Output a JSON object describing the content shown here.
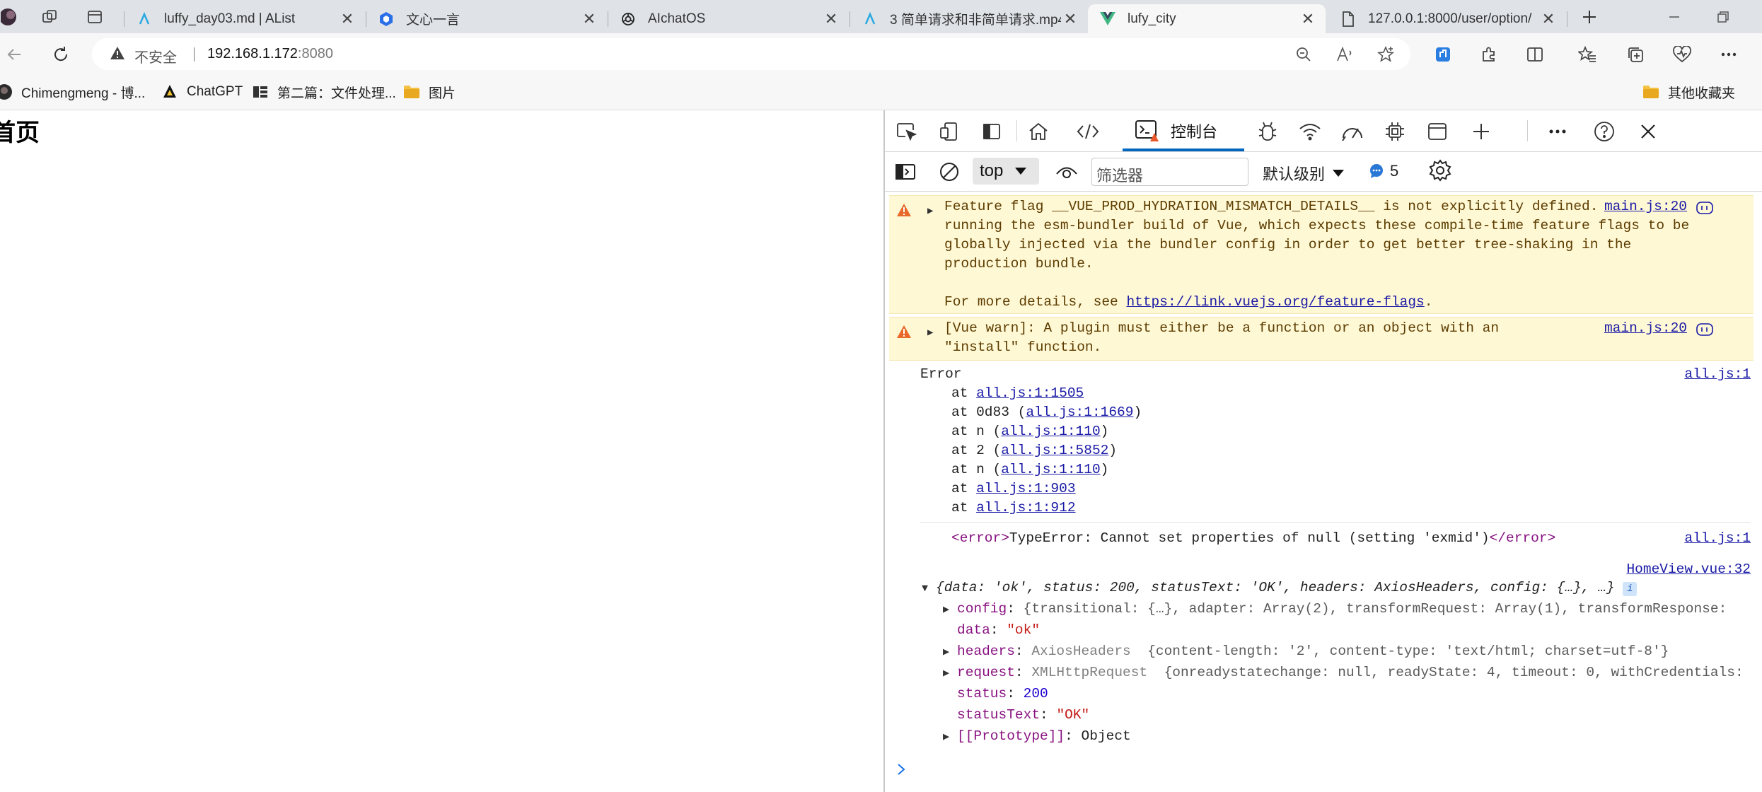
{
  "tabs": [
    {
      "label": "luffy_day03.md | AList",
      "icon": "alist-icon"
    },
    {
      "label": "文心一言",
      "icon": "wenxin-icon"
    },
    {
      "label": "AIchatOS",
      "icon": "openai-icon"
    },
    {
      "label": "3 简单请求和非简单请求.mp4",
      "icon": "alist-icon"
    },
    {
      "label": "lufy_city",
      "icon": "vue-icon"
    },
    {
      "label": "127.0.0.1:8000/user/option/",
      "icon": "document-icon"
    }
  ],
  "address_bar": {
    "insecure_label": "不安全",
    "url_host": "192.168.1.172",
    "url_port": ":8080"
  },
  "bookmarks": [
    {
      "label": "Chimengmeng - 博...",
      "icon": "blog-icon"
    },
    {
      "label": "ChatGPT",
      "icon": "chatgpt-icon"
    },
    {
      "label": "第二篇：文件处理...",
      "icon": "csdn-icon"
    },
    {
      "label": "图片",
      "icon": "folder-icon"
    }
  ],
  "other_bookmarks": "其他收藏夹",
  "page": {
    "heading": "首页"
  },
  "devtools": {
    "console_tab": "控制台",
    "context": "top",
    "filter_placeholder": "筛选器",
    "levels": "默认级别",
    "message_count": "5",
    "messages": {
      "warn1": {
        "text": "Feature flag __VUE_PROD_HYDRATION_MISMATCH_DETAILS__ is not explicitly defined. You are running the esm-bundler build of Vue, which expects these compile-time feature flags to be globally injected via the bundler config in order to get better tree-shaking in the production bundle.",
        "more_prefix": "For more details, see ",
        "more_link": "https://link.vuejs.org/feature-flags",
        "more_suffix": ".",
        "source": "main.js:20"
      },
      "warn2": {
        "text": "[Vue warn]: A plugin must either be a function or an object with an \"install\" function.",
        "source": "main.js:20"
      },
      "error": {
        "title": "Error",
        "source": "all.js:1",
        "stack": [
          {
            "prefix": "at ",
            "link": "all.js:1:1505",
            "suffix": ""
          },
          {
            "prefix": "at 0d83 (",
            "link": "all.js:1:1669",
            "suffix": ")"
          },
          {
            "prefix": "at n (",
            "link": "all.js:1:110",
            "suffix": ")"
          },
          {
            "prefix": "at 2 (",
            "link": "all.js:1:5852",
            "suffix": ")"
          },
          {
            "prefix": "at n (",
            "link": "all.js:1:110",
            "suffix": ")"
          },
          {
            "prefix": "at ",
            "link": "all.js:1:903",
            "suffix": ""
          },
          {
            "prefix": "at ",
            "link": "all.js:1:912",
            "suffix": ""
          }
        ]
      },
      "error2": {
        "open_tag": "<error>",
        "text": "TypeError: Cannot set properties of null (setting 'exmid')",
        "close_tag": "</error>",
        "source": "all.js:1"
      },
      "log": {
        "source": "HomeView.vue:32",
        "summary": "{data: 'ok', status: 200, statusText: 'OK', headers: AxiosHeaders, config: {…}, …}",
        "info_badge": "i",
        "props": {
          "config_key": "config",
          "config_val": "{transitional: {…}, adapter: Array(2), transformRequest: Array(1), transformResponse:",
          "data_key": "data",
          "data_val": "\"ok\"",
          "headers_key": "headers",
          "headers_type": "AxiosHeaders",
          "headers_val": "{content-length: '2', content-type: 'text/html; charset=utf-8'}",
          "request_key": "request",
          "request_type": "XMLHttpRequest",
          "request_val": "{onreadystatechange: null, readyState: 4, timeout: 0, withCredentials:",
          "status_key": "status",
          "status_val": "200",
          "statusText_key": "statusText",
          "statusText_val": "\"OK\"",
          "proto_key": "[[Prototype]]",
          "proto_val": "Object"
        }
      }
    }
  }
}
